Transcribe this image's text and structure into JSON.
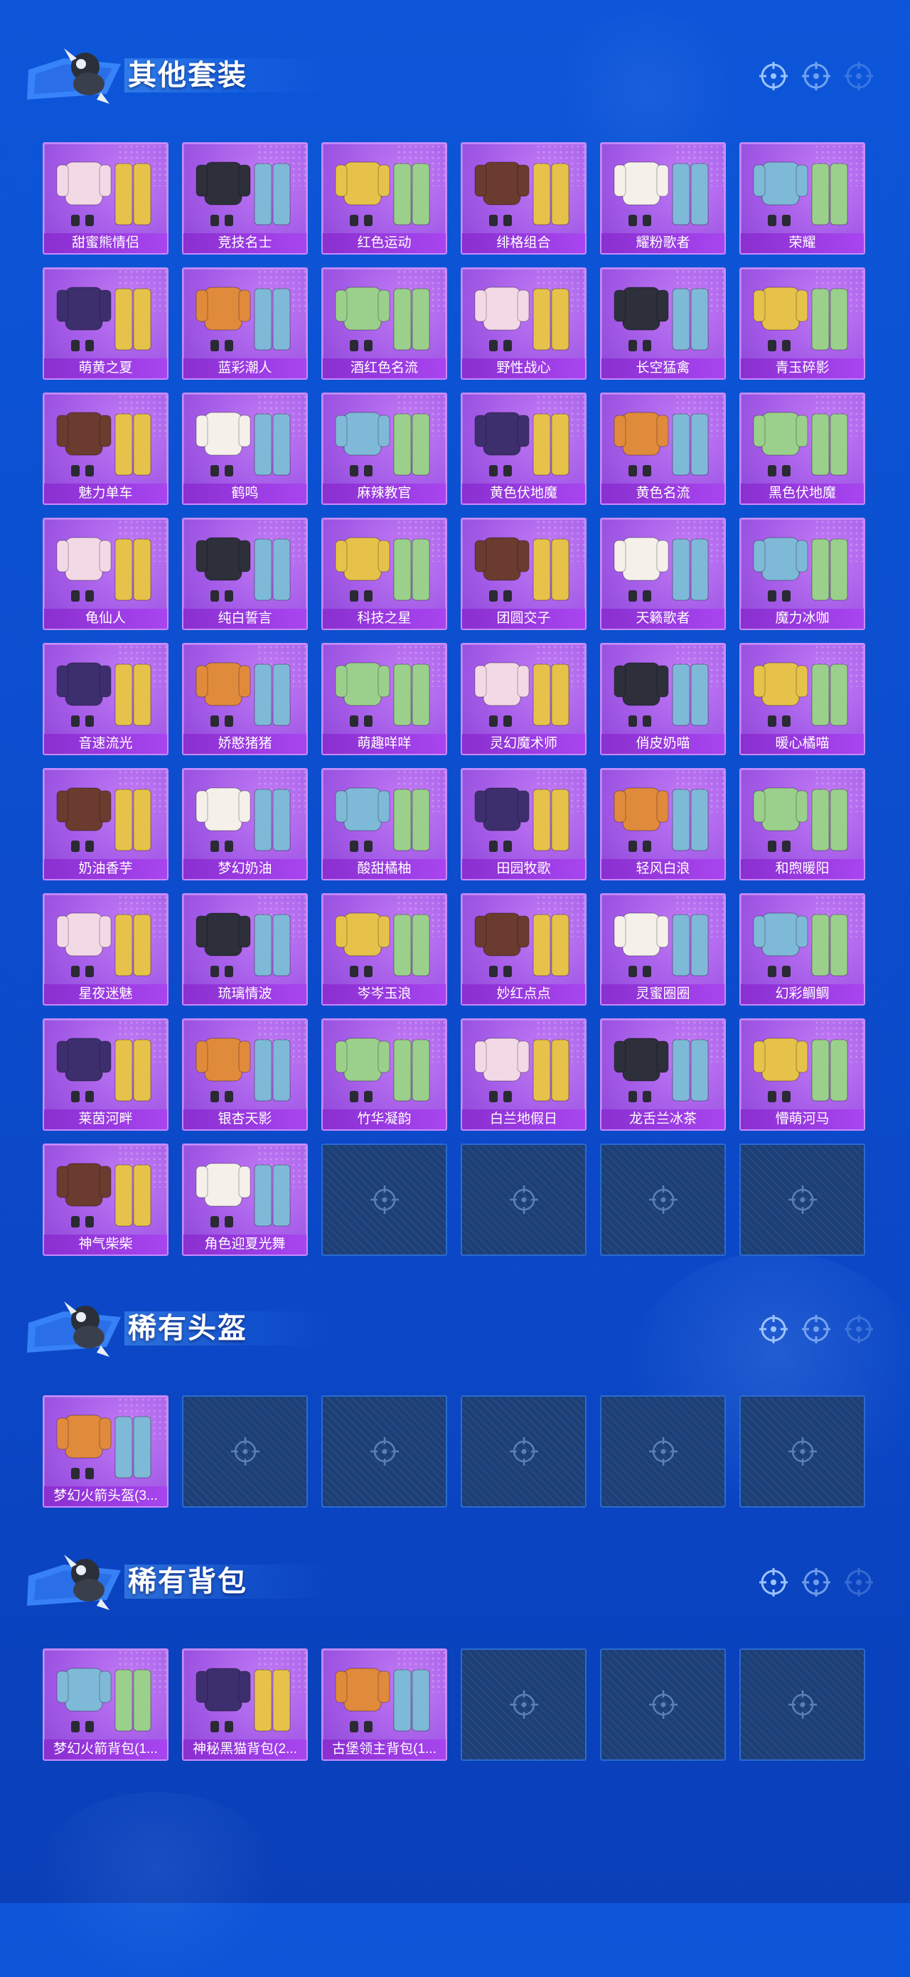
{
  "colors": {
    "background": "#0c4fd0",
    "card_purple": "#a55de8",
    "label_purple": "#8a2fd0",
    "empty_slot": "#1c3f78",
    "title_text": "#ffffff"
  },
  "sections": [
    {
      "title": "其他套装",
      "items": [
        "甜蜜熊情侣",
        "竞技名士",
        "红色运动",
        "绯格组合",
        "耀粉歌者",
        "荣耀",
        "萌黄之夏",
        "蓝彩潮人",
        "酒红色名流",
        "野性战心",
        "长空猛禽",
        "青玉碎影",
        "魅力单车",
        "鹤鸣",
        "麻辣教官",
        "黄色伏地魔",
        "黄色名流",
        "黑色伏地魔",
        "龟仙人",
        "纯白誓言",
        "科技之星",
        "团圆交子",
        "天籁歌者",
        "魔力冰咖",
        "音速流光",
        "娇憨猪猪",
        "萌趣咩咩",
        "灵幻魔术师",
        "俏皮奶喵",
        "暖心橘喵",
        "奶油香芋",
        "梦幻奶油",
        "酸甜橘柚",
        "田园牧歌",
        "轻风白浪",
        "和煦暖阳",
        "星夜迷魅",
        "琉璃情波",
        "岑岑玉浪",
        "妙红点点",
        "灵蜜圈圈",
        "幻彩鲷鲷",
        "莱茵河畔",
        "银杏天影",
        "竹华凝韵",
        "白兰地假日",
        "龙舌兰冰茶",
        "懵萌河马",
        "神气柴柴",
        "角色迎夏光舞"
      ],
      "empty_slots": 4
    },
    {
      "title": "稀有头盔",
      "items": [
        "梦幻火箭头盔(3..."
      ],
      "empty_slots": 5
    },
    {
      "title": "稀有背包",
      "items": [
        "梦幻火箭背包(1...",
        "神秘黑猫背包(2...",
        "古堡领主背包(1..."
      ],
      "empty_slots": 3
    }
  ],
  "icons": {
    "header": [
      "crosshair-icon",
      "crosshair-icon",
      "crosshair-icon"
    ],
    "empty_slot": "crosshair-icon",
    "mascot": "skydiver-mascot-icon"
  }
}
